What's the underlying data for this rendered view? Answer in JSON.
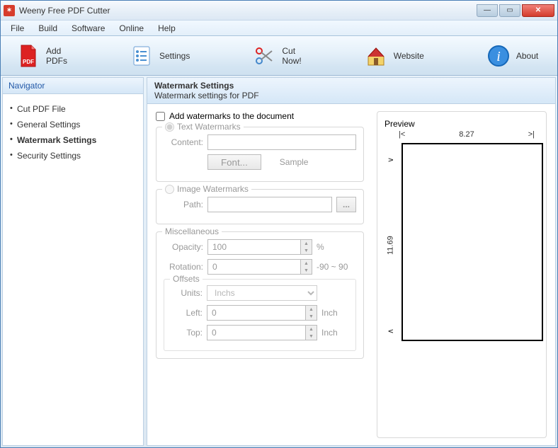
{
  "app": {
    "title": "Weeny Free PDF Cutter"
  },
  "menu": {
    "items": [
      "File",
      "Build",
      "Software",
      "Online",
      "Help"
    ]
  },
  "toolbar": {
    "add": "Add PDFs",
    "settings": "Settings",
    "cut": "Cut Now!",
    "website": "Website",
    "about": "About"
  },
  "navigator": {
    "header": "Navigator",
    "items": [
      "Cut PDF File",
      "General Settings",
      "Watermark Settings",
      "Security Settings"
    ],
    "activeIndex": 2
  },
  "panel": {
    "title": "Watermark Settings",
    "subtitle": "Watermark settings for PDF"
  },
  "form": {
    "add_check_label": "Add watermarks to the document",
    "text_wm": {
      "legend": "Text Watermarks",
      "content_label": "Content:",
      "content_value": "",
      "font_btn": "Font...",
      "sample": "Sample"
    },
    "image_wm": {
      "legend": "Image Watermarks",
      "path_label": "Path:",
      "path_value": ""
    },
    "misc": {
      "legend": "Miscellaneous",
      "opacity_label": "Opacity:",
      "opacity_value": "100",
      "opacity_suffix": "%",
      "rotation_label": "Rotation:",
      "rotation_value": "0",
      "rotation_suffix": "-90 ~ 90",
      "offsets": {
        "legend": "Offsets",
        "units_label": "Units:",
        "units_value": "Inchs",
        "left_label": "Left:",
        "left_value": "0",
        "left_suffix": "Inch",
        "top_label": "Top:",
        "top_value": "0",
        "top_suffix": "Inch"
      }
    },
    "preview": {
      "legend": "Preview",
      "width": "8.27",
      "height": "11.69",
      "lmark": "|<",
      "rmark": ">|",
      "tmark": "∧",
      "bmark": "∨"
    }
  }
}
